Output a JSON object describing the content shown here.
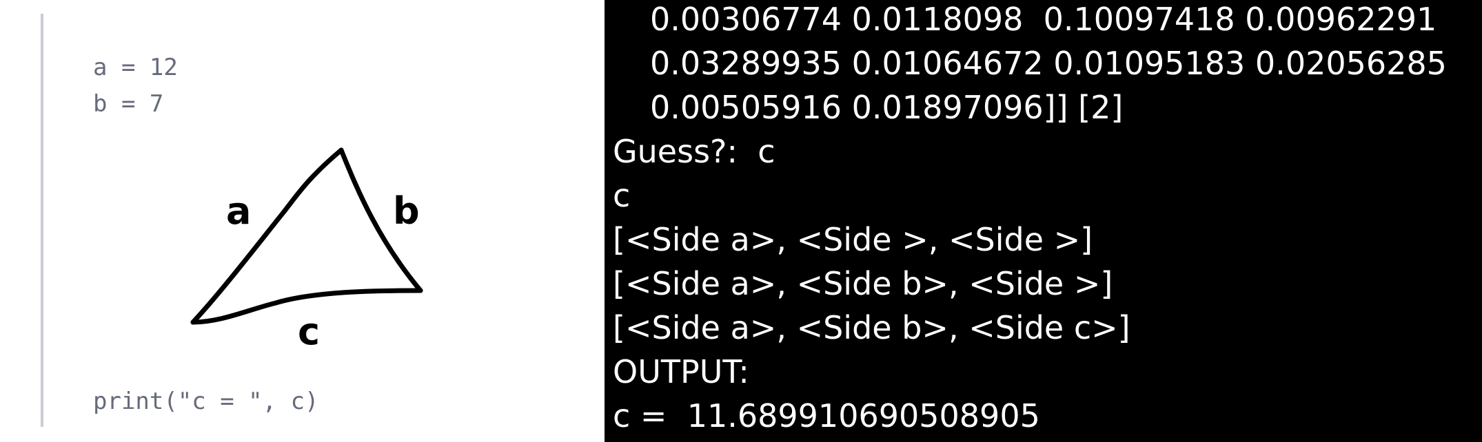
{
  "code": {
    "line_a": "a = 12",
    "line_b": "b = 7",
    "print_line": "print(\"c = \", c)"
  },
  "sketch": {
    "label_a": "a",
    "label_b": "b",
    "label_c": "c"
  },
  "terminal": {
    "lines": [
      "0.00306774 0.0118098  0.10097418 0.00962291",
      "0.03289935 0.01064672 0.01095183 0.02056285",
      "0.00505916 0.01897096]] [2]",
      "Guess?:  c",
      "c",
      "[<Side a>, <Side >, <Side >]",
      "[<Side a>, <Side b>, <Side >]",
      "[<Side a>, <Side b>, <Side c>]",
      "OUTPUT:",
      "c =  11.689910690508905"
    ]
  },
  "colors": {
    "terminal_bg": "#000000",
    "terminal_text": "#ffffff",
    "code_text": "#666b7a",
    "rule": "#c9ccd6"
  }
}
